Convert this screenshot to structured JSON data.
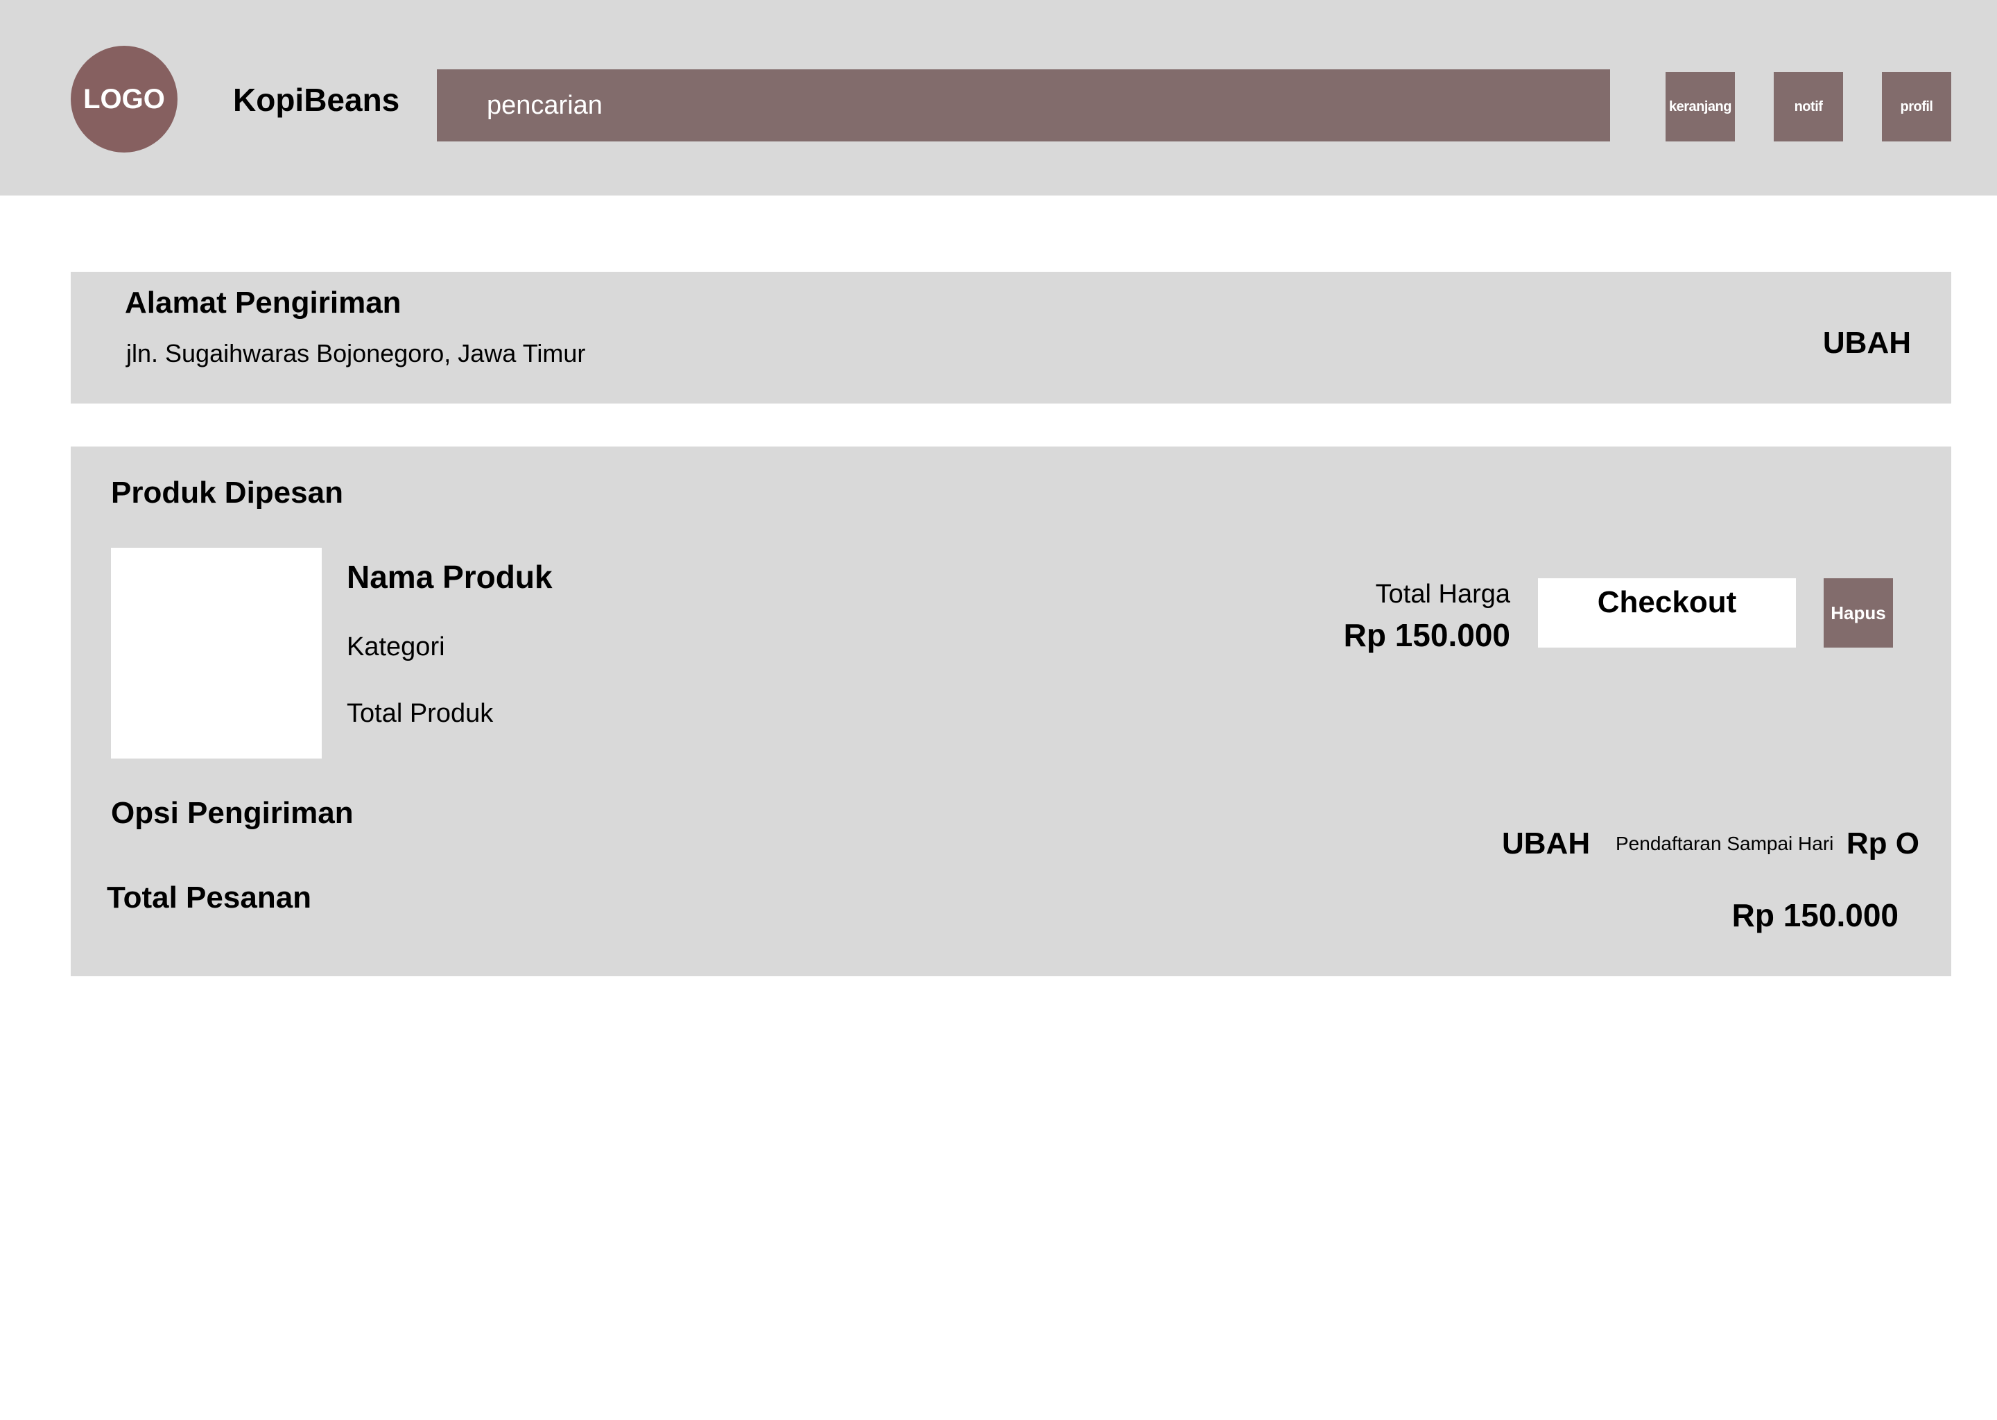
{
  "header": {
    "logo_text": "LOGO",
    "brand": "KopiBeans",
    "search_placeholder": "pencarian",
    "icons": {
      "cart": "keranjang",
      "notif": "notif",
      "profile": "profil"
    }
  },
  "address": {
    "title": "Alamat Pengiriman",
    "value": "jln. Sugaihwaras Bojonegoro, Jawa Timur",
    "change_label": "UBAH"
  },
  "order": {
    "title": "Produk Dipesan",
    "product": {
      "name": "Nama Produk",
      "category": "Kategori",
      "quantity_label": "Total Produk"
    },
    "total_price_label": "Total Harga",
    "total_price_value": "Rp 150.000",
    "checkout_label": "Checkout",
    "delete_label": "Hapus",
    "shipping": {
      "title": "Opsi Pengiriman",
      "change_label": "UBAH",
      "option": "Pendaftaran Sampai Hari",
      "cost": "Rp O"
    },
    "grand_total_label": "Total Pesanan",
    "grand_total_value": "Rp 150.000"
  },
  "colors": {
    "panel": "#d9d9d9",
    "accent": "#826c6c",
    "logo": "#866060"
  }
}
